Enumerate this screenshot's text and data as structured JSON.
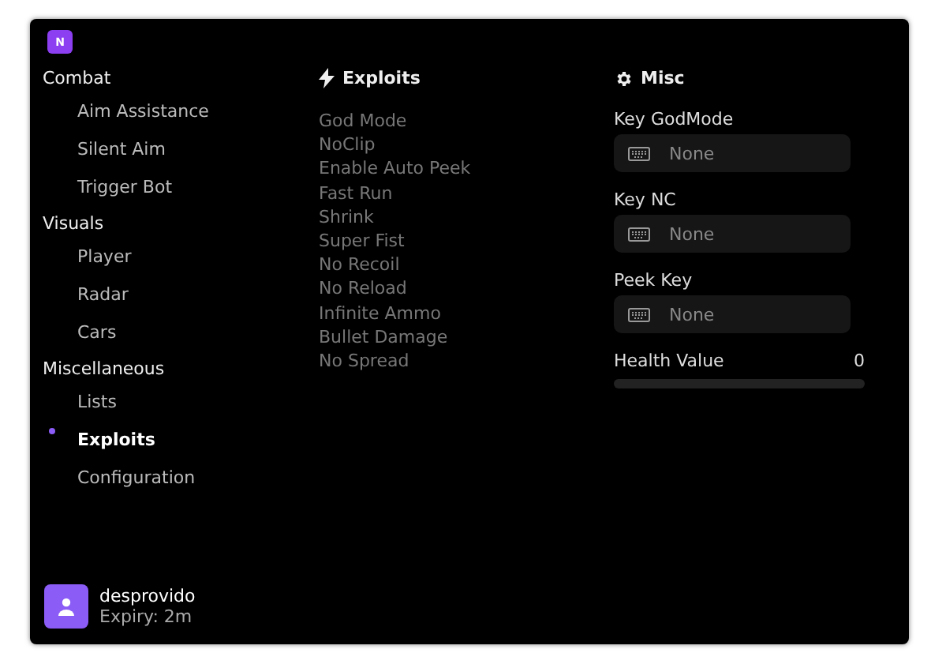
{
  "logo": "N",
  "sidebar": [
    {
      "title": "Combat",
      "items": [
        {
          "label": "Aim Assistance",
          "selected": false
        },
        {
          "label": "Silent Aim",
          "selected": false
        },
        {
          "label": "Trigger Bot",
          "selected": false
        }
      ]
    },
    {
      "title": "Visuals",
      "items": [
        {
          "label": "Player",
          "selected": false
        },
        {
          "label": "Radar",
          "selected": false
        },
        {
          "label": "Cars",
          "selected": false
        }
      ]
    },
    {
      "title": "Miscellaneous",
      "items": [
        {
          "label": "Lists",
          "selected": false
        },
        {
          "label": "Exploits",
          "selected": true
        },
        {
          "label": "Configuration",
          "selected": false
        }
      ]
    }
  ],
  "exploits": {
    "title": "Exploits",
    "items": [
      "God Mode",
      "NoClip",
      "Enable Auto Peek",
      "Fast Run",
      "Shrink",
      "Super Fist",
      "No Recoil",
      "No Reload",
      "Infinite Ammo",
      "Bullet Damage",
      "No Spread"
    ]
  },
  "misc": {
    "title": "Misc",
    "keybinds": [
      {
        "label": "Key GodMode",
        "value": "None"
      },
      {
        "label": "Key NC",
        "value": "None"
      },
      {
        "label": "Peek Key",
        "value": "None"
      }
    ],
    "sliders": [
      {
        "label": "Health Value",
        "reading": "0",
        "level": 0
      }
    ]
  },
  "user": {
    "name": "desprovido",
    "expiry": "Expiry: 2m"
  }
}
